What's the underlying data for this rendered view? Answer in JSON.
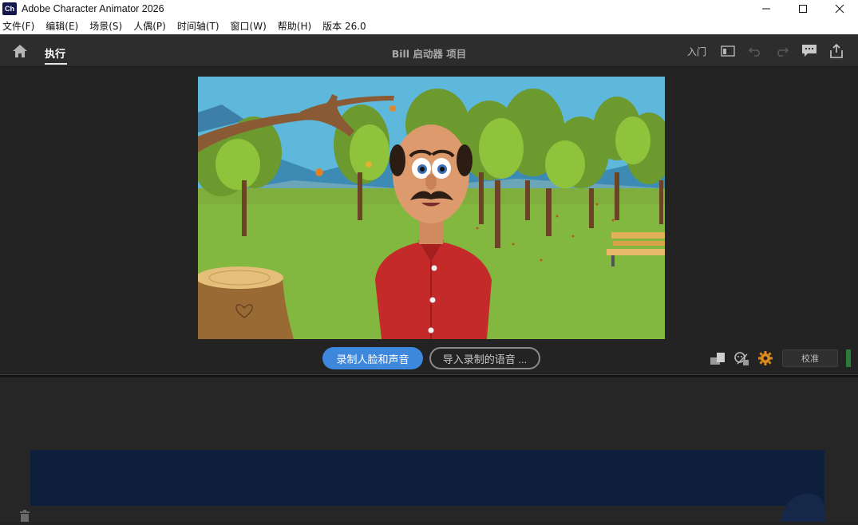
{
  "window": {
    "logo_text": "Ch",
    "title": "Adobe Character Animator 2026"
  },
  "menu": {
    "items": [
      "文件(F)",
      "编辑(E)",
      "场景(S)",
      "人偶(P)",
      "时间轴(T)",
      "窗口(W)",
      "帮助(H)",
      "版本 26.0"
    ]
  },
  "header": {
    "tab_run": "执行",
    "project_title": "Bill 启动器 项目",
    "intro_label": "入门"
  },
  "stage": {
    "record_button": "录制人脸和声音",
    "import_button": "导入录制的语音 ...",
    "calibrate_button": "校准"
  },
  "colors": {
    "accent": "#3d87dd",
    "background": "#232323",
    "timeline": "#0e1f3d",
    "level_meter": "#2c7a3a"
  },
  "icons": [
    "home-icon",
    "panel-icon",
    "undo-icon",
    "redo-icon",
    "comment-icon",
    "share-icon",
    "pose-icon",
    "face-tracking-icon",
    "settings-icon",
    "trash-icon"
  ]
}
